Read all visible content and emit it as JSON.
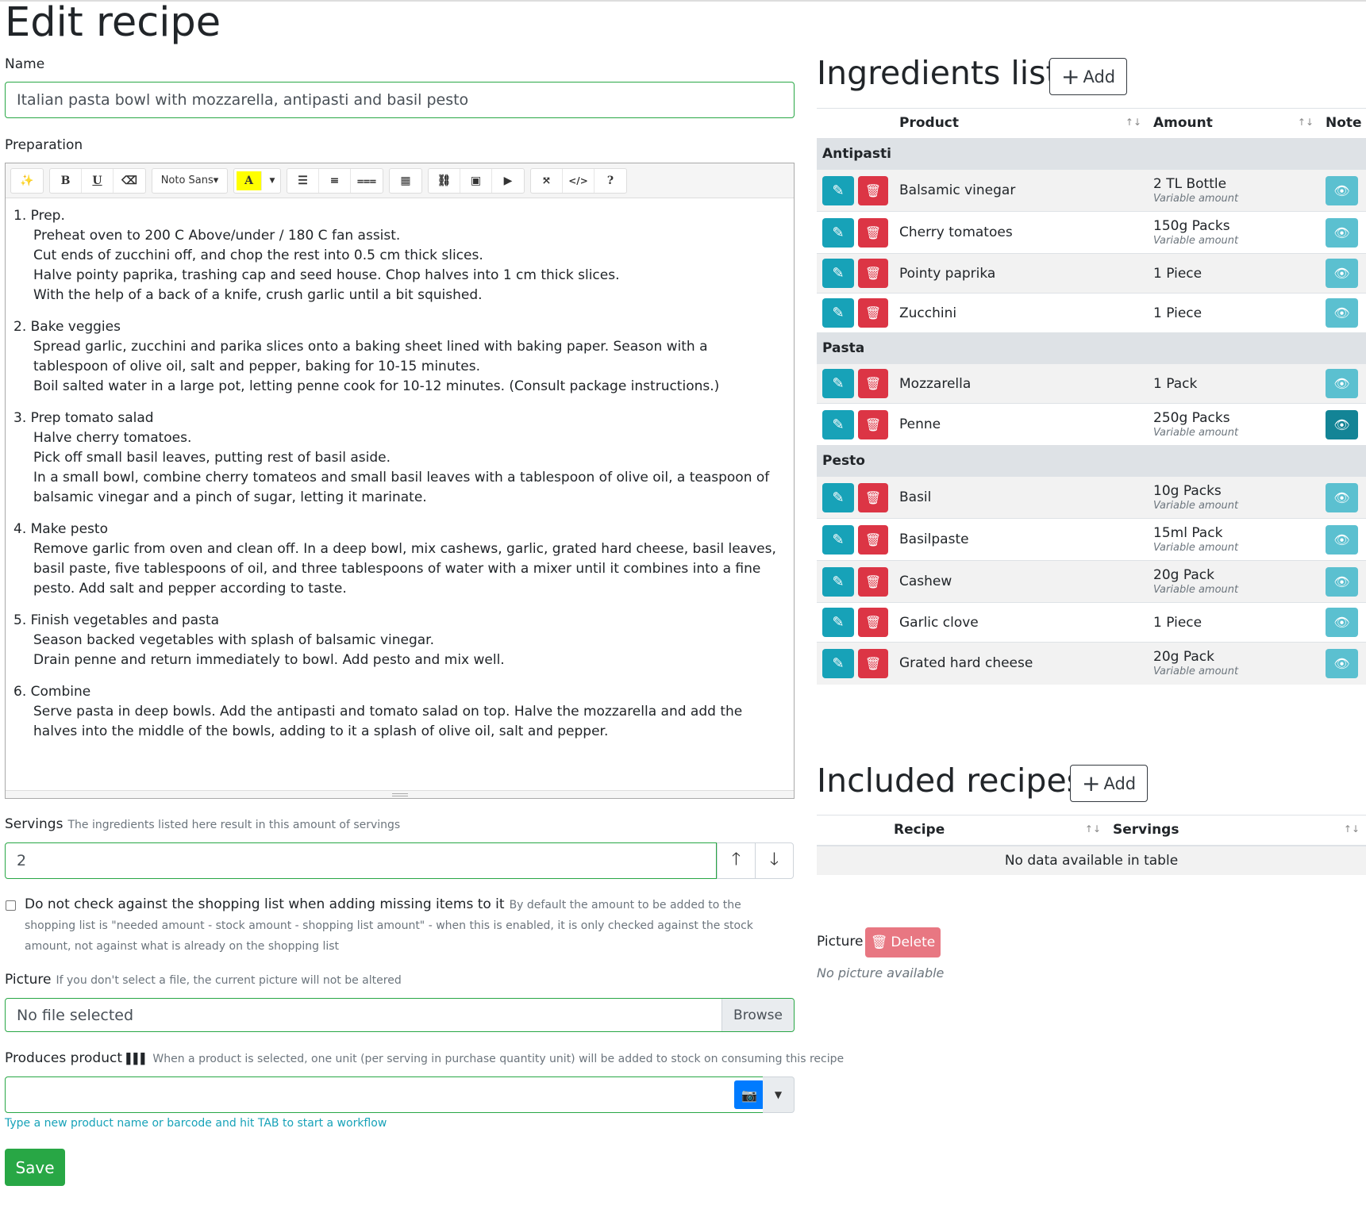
{
  "page_title": "Edit recipe",
  "name": {
    "label": "Name",
    "value": "Italian pasta bowl with mozzarella, antipasti and basil pesto"
  },
  "preparation": {
    "label": "Preparation",
    "toolbar": {
      "font": "Noto Sans"
    },
    "steps": [
      {
        "title": "1. Prep.",
        "lines": [
          "Preheat oven to 200 C Above/under / 180 C fan assist.",
          "Cut ends of zucchini off, and chop the rest into 0.5 cm thick slices.",
          "Halve pointy paprika, trashing cap and seed house. Chop halves into 1 cm thick slices.",
          "With the help of a back of a knife, crush garlic until a bit squished."
        ]
      },
      {
        "title": "2. Bake veggies",
        "lines": [
          "Spread garlic, zucchini and parika slices onto a baking sheet lined with baking paper. Season with a tablespoon of olive oil, salt and pepper, baking for 10-15 minutes.",
          "Boil salted water in a large pot, letting penne cook for 10-12 minutes. (Consult package instructions.)"
        ]
      },
      {
        "title": "3. Prep tomato salad",
        "lines": [
          "Halve cherry tomatoes.",
          "Pick off small basil leaves, putting rest of basil aside.",
          "In a small bowl, combine cherry tomateos and small basil leaves with a tablespoon of olive oil, a teaspoon of balsamic vinegar and a pinch of sugar, letting it marinate."
        ]
      },
      {
        "title": "4. Make pesto",
        "lines": [
          "Remove garlic from oven and clean off. In a deep bowl, mix cashews, garlic, grated hard cheese, basil leaves, basil paste, five tablespoons of oil, and three tablespoons of water with a mixer until it combines into a fine pesto. Add salt and pepper according to taste."
        ]
      },
      {
        "title": "5. Finish vegetables and pasta",
        "lines": [
          "Season backed vegetables with splash of balsamic vinegar.",
          "Drain penne and return immediately to bowl. Add pesto and mix well."
        ]
      },
      {
        "title": "6. Combine",
        "lines": [
          "Serve pasta in deep bowls. Add the antipasti and tomato salad on top. Halve the mozzarella and add the halves into the middle of the bowls, adding to it a splash of olive oil, salt and pepper."
        ]
      }
    ]
  },
  "servings": {
    "label": "Servings",
    "hint": "The ingredients listed here result in this amount of servings",
    "value": "2"
  },
  "shopping_check": {
    "label": "Do not check against the shopping list when adding missing items to it",
    "hint": "By default the amount to be added to the shopping list is \"needed amount - stock amount - shopping list amount\" - when this is enabled, it is only checked against the stock amount, not against what is already on the shopping list",
    "checked": false
  },
  "picture_field": {
    "label": "Picture",
    "hint": "If you don't select a file, the current picture will not be altered",
    "value": "No file selected",
    "browse": "Browse"
  },
  "produces": {
    "label": "Produces product",
    "hint": "When a product is selected, one unit (per serving in purchase quantity unit) will be added to stock on consuming this recipe",
    "value": "",
    "workflow_hint": "Type a new product name or barcode and hit TAB to start a workflow"
  },
  "save_label": "Save",
  "ingredients": {
    "title": "Ingredients list",
    "add_label": "Add",
    "columns": [
      "Product",
      "Amount",
      "Note"
    ],
    "groups": [
      {
        "name": "Antipasti",
        "items": [
          {
            "product": "Balsamic vinegar",
            "amount": "2 TL Bottle",
            "variable": "Variable amount"
          },
          {
            "product": "Cherry tomatoes",
            "amount": "150g Packs",
            "variable": "Variable amount"
          },
          {
            "product": "Pointy paprika",
            "amount": "1 Piece",
            "variable": ""
          },
          {
            "product": "Zucchini",
            "amount": "1 Piece",
            "variable": ""
          }
        ]
      },
      {
        "name": "Pasta",
        "items": [
          {
            "product": "Mozzarella",
            "amount": "1 Pack",
            "variable": ""
          },
          {
            "product": "Penne",
            "amount": "250g Packs",
            "variable": "Variable amount"
          }
        ]
      },
      {
        "name": "Pesto",
        "items": [
          {
            "product": "Basil",
            "amount": "10g Packs",
            "variable": "Variable amount"
          },
          {
            "product": "Basilpaste",
            "amount": "15ml Pack",
            "variable": "Variable amount"
          },
          {
            "product": "Cashew",
            "amount": "20g Pack",
            "variable": "Variable amount"
          },
          {
            "product": "Garlic clove",
            "amount": "1 Piece",
            "variable": ""
          },
          {
            "product": "Grated hard cheese",
            "amount": "20g Pack",
            "variable": "Variable amount"
          }
        ]
      }
    ]
  },
  "included": {
    "title": "Included recipes",
    "add_label": "Add",
    "columns": [
      "Recipe",
      "Servings"
    ],
    "empty": "No data available in table"
  },
  "picture_panel": {
    "label": "Picture",
    "delete_label": "Delete",
    "none": "No picture available"
  }
}
